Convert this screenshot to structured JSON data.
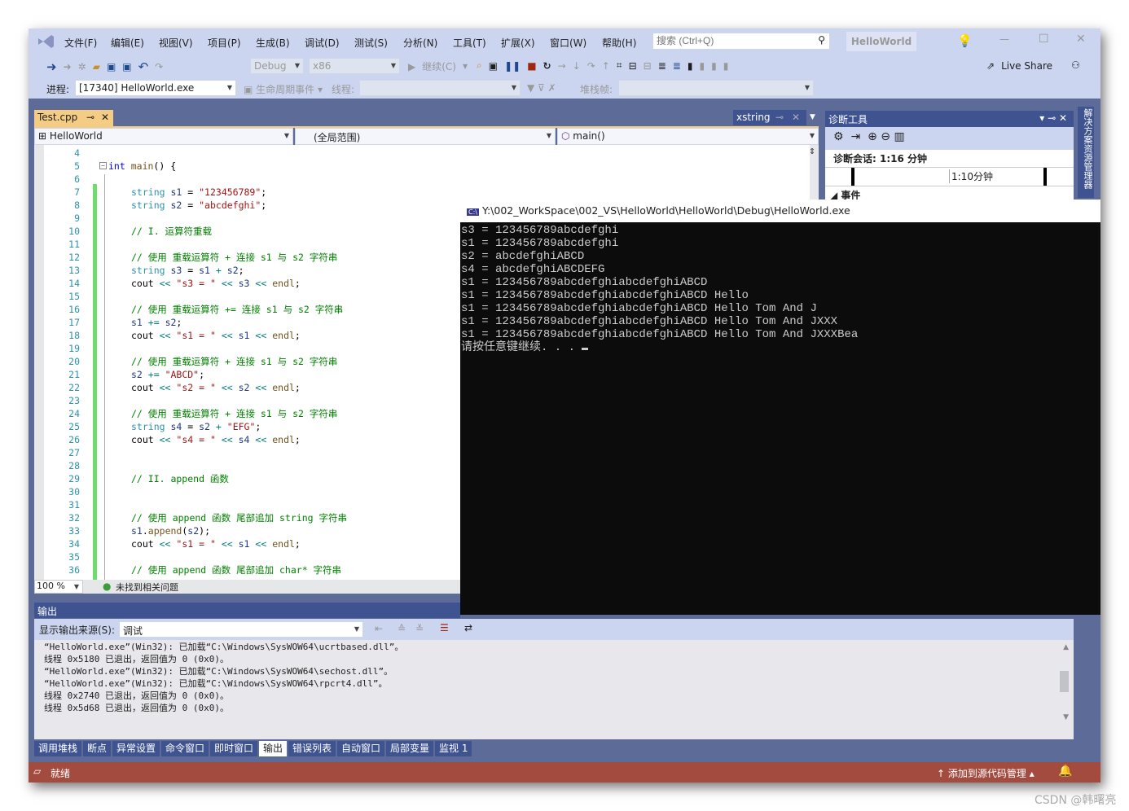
{
  "menu": [
    "文件(F)",
    "编辑(E)",
    "视图(V)",
    "项目(P)",
    "生成(B)",
    "调试(D)",
    "测试(S)",
    "分析(N)",
    "工具(T)",
    "扩展(X)",
    "窗口(W)",
    "帮助(H)"
  ],
  "search": {
    "placeholder": "搜索 (Ctrl+Q)"
  },
  "solution_name": "HelloWorld",
  "toolbar": {
    "config": "Debug",
    "platform": "x86",
    "continue": "继续(C)",
    "live_share": "Live Share"
  },
  "debugbar": {
    "process_label": "进程:",
    "process_value": "[17340] HelloWorld.exe",
    "lifecycle": "生命周期事件",
    "thread_label": "线程:",
    "stack_label": "堆栈帧:"
  },
  "tabs": {
    "active": "Test.cpp",
    "other": "xstring"
  },
  "navbar": {
    "project": "HelloWorld",
    "scope": "(全局范围)",
    "member": "main()"
  },
  "code": [
    {
      "n": "4",
      "t": []
    },
    {
      "n": "5",
      "t": [
        [
          "kw",
          "int"
        ],
        [
          "pl",
          " "
        ],
        [
          "fn",
          "main"
        ],
        [
          "pl",
          "() {"
        ]
      ],
      "root": true
    },
    {
      "n": "6",
      "t": []
    },
    {
      "n": "7",
      "t": [
        [
          "ty",
          "string"
        ],
        [
          "pl",
          " "
        ],
        [
          "va",
          "s1"
        ],
        [
          "pl",
          " = "
        ],
        [
          "st",
          "\"123456789\""
        ],
        [
          "pl",
          ";"
        ]
      ]
    },
    {
      "n": "8",
      "t": [
        [
          "ty",
          "string"
        ],
        [
          "pl",
          " "
        ],
        [
          "va",
          "s2"
        ],
        [
          "pl",
          " = "
        ],
        [
          "st",
          "\"abcdefghi\""
        ],
        [
          "pl",
          ";"
        ]
      ]
    },
    {
      "n": "9",
      "t": []
    },
    {
      "n": "10",
      "t": [
        [
          "cm",
          "// I. 运算符重载"
        ]
      ]
    },
    {
      "n": "11",
      "t": []
    },
    {
      "n": "12",
      "t": [
        [
          "cm",
          "// 使用 重载运算符 + 连接 s1 与 s2 字符串"
        ]
      ]
    },
    {
      "n": "13",
      "t": [
        [
          "ty",
          "string"
        ],
        [
          "pl",
          " "
        ],
        [
          "va",
          "s3"
        ],
        [
          "pl",
          " = "
        ],
        [
          "va",
          "s1"
        ],
        [
          "op",
          " + "
        ],
        [
          "va",
          "s2"
        ],
        [
          "pl",
          ";"
        ]
      ]
    },
    {
      "n": "14",
      "t": [
        [
          "pl",
          "cout "
        ],
        [
          "op",
          "<<"
        ],
        [
          "pl",
          " "
        ],
        [
          "st",
          "\"s3 = \""
        ],
        [
          "pl",
          " "
        ],
        [
          "op",
          "<<"
        ],
        [
          "pl",
          " "
        ],
        [
          "va",
          "s3"
        ],
        [
          "pl",
          " "
        ],
        [
          "op",
          "<<"
        ],
        [
          "pl",
          " "
        ],
        [
          "fn",
          "endl"
        ],
        [
          "pl",
          ";"
        ]
      ]
    },
    {
      "n": "15",
      "t": []
    },
    {
      "n": "16",
      "t": [
        [
          "cm",
          "// 使用 重载运算符 += 连接 s1 与 s2 字符串"
        ]
      ]
    },
    {
      "n": "17",
      "t": [
        [
          "va",
          "s1"
        ],
        [
          "op",
          " += "
        ],
        [
          "va",
          "s2"
        ],
        [
          "pl",
          ";"
        ]
      ]
    },
    {
      "n": "18",
      "t": [
        [
          "pl",
          "cout "
        ],
        [
          "op",
          "<<"
        ],
        [
          "pl",
          " "
        ],
        [
          "st",
          "\"s1 = \""
        ],
        [
          "pl",
          " "
        ],
        [
          "op",
          "<<"
        ],
        [
          "pl",
          " "
        ],
        [
          "va",
          "s1"
        ],
        [
          "pl",
          " "
        ],
        [
          "op",
          "<<"
        ],
        [
          "pl",
          " "
        ],
        [
          "fn",
          "endl"
        ],
        [
          "pl",
          ";"
        ]
      ]
    },
    {
      "n": "19",
      "t": []
    },
    {
      "n": "20",
      "t": [
        [
          "cm",
          "// 使用 重载运算符 + 连接 s1 与 s2 字符串"
        ]
      ]
    },
    {
      "n": "21",
      "t": [
        [
          "va",
          "s2"
        ],
        [
          "op",
          " += "
        ],
        [
          "st",
          "\"ABCD\""
        ],
        [
          "pl",
          ";"
        ]
      ]
    },
    {
      "n": "22",
      "t": [
        [
          "pl",
          "cout "
        ],
        [
          "op",
          "<<"
        ],
        [
          "pl",
          " "
        ],
        [
          "st",
          "\"s2 = \""
        ],
        [
          "pl",
          " "
        ],
        [
          "op",
          "<<"
        ],
        [
          "pl",
          " "
        ],
        [
          "va",
          "s2"
        ],
        [
          "pl",
          " "
        ],
        [
          "op",
          "<<"
        ],
        [
          "pl",
          " "
        ],
        [
          "fn",
          "endl"
        ],
        [
          "pl",
          ";"
        ]
      ]
    },
    {
      "n": "23",
      "t": []
    },
    {
      "n": "24",
      "t": [
        [
          "cm",
          "// 使用 重载运算符 + 连接 s1 与 s2 字符串"
        ]
      ]
    },
    {
      "n": "25",
      "t": [
        [
          "ty",
          "string"
        ],
        [
          "pl",
          " "
        ],
        [
          "va",
          "s4"
        ],
        [
          "pl",
          " = "
        ],
        [
          "va",
          "s2"
        ],
        [
          "op",
          " + "
        ],
        [
          "st",
          "\"EFG\""
        ],
        [
          "pl",
          ";"
        ]
      ]
    },
    {
      "n": "26",
      "t": [
        [
          "pl",
          "cout "
        ],
        [
          "op",
          "<<"
        ],
        [
          "pl",
          " "
        ],
        [
          "st",
          "\"s4 = \""
        ],
        [
          "pl",
          " "
        ],
        [
          "op",
          "<<"
        ],
        [
          "pl",
          " "
        ],
        [
          "va",
          "s4"
        ],
        [
          "pl",
          " "
        ],
        [
          "op",
          "<<"
        ],
        [
          "pl",
          " "
        ],
        [
          "fn",
          "endl"
        ],
        [
          "pl",
          ";"
        ]
      ]
    },
    {
      "n": "27",
      "t": []
    },
    {
      "n": "28",
      "t": []
    },
    {
      "n": "29",
      "t": [
        [
          "cm",
          "// II. append 函数"
        ]
      ]
    },
    {
      "n": "30",
      "t": []
    },
    {
      "n": "31",
      "t": []
    },
    {
      "n": "32",
      "t": [
        [
          "cm",
          "// 使用 append 函数 尾部追加 string 字符串"
        ]
      ]
    },
    {
      "n": "33",
      "t": [
        [
          "va",
          "s1"
        ],
        [
          "pl",
          "."
        ],
        [
          "fn",
          "append"
        ],
        [
          "pl",
          "("
        ],
        [
          "va",
          "s2"
        ],
        [
          "pl",
          ");"
        ]
      ]
    },
    {
      "n": "34",
      "t": [
        [
          "pl",
          "cout "
        ],
        [
          "op",
          "<<"
        ],
        [
          "pl",
          " "
        ],
        [
          "st",
          "\"s1 = \""
        ],
        [
          "pl",
          " "
        ],
        [
          "op",
          "<<"
        ],
        [
          "pl",
          " "
        ],
        [
          "va",
          "s1"
        ],
        [
          "pl",
          " "
        ],
        [
          "op",
          "<<"
        ],
        [
          "pl",
          " "
        ],
        [
          "fn",
          "endl"
        ],
        [
          "pl",
          ";"
        ]
      ]
    },
    {
      "n": "35",
      "t": []
    },
    {
      "n": "36",
      "t": [
        [
          "cm",
          "// 使用 append 函数 尾部追加 char* 字符串"
        ]
      ]
    }
  ],
  "editor_status": {
    "zoom": "100 %",
    "issues": "未找到相关问题"
  },
  "diagnostics": {
    "title": "诊断工具",
    "session": "诊断会话: 1:16 分钟",
    "timeline_label": "1:10分钟",
    "events": "事件"
  },
  "solution_explorer_tab": "解决方案资源管理器",
  "console": {
    "title": "Y:\\002_WorkSpace\\002_VS\\HelloWorld\\HelloWorld\\Debug\\HelloWorld.exe",
    "lines": [
      "s3 = 123456789abcdefghi",
      "s1 = 123456789abcdefghi",
      "s2 = abcdefghiABCD",
      "s4 = abcdefghiABCDEFG",
      "s1 = 123456789abcdefghiabcdefghiABCD",
      "s1 = 123456789abcdefghiabcdefghiABCD Hello",
      "s1 = 123456789abcdefghiabcdefghiABCD Hello Tom And J",
      "s1 = 123456789abcdefghiabcdefghiABCD Hello Tom And JXXX",
      "s1 = 123456789abcdefghiabcdefghiABCD Hello Tom And JXXXBea"
    ],
    "prompt": "请按任意键继续. . . "
  },
  "output": {
    "title": "输出",
    "source_label": "显示输出来源(S):",
    "source_value": "调试",
    "lines": [
      "“HelloWorld.exe”(Win32): 已加载“C:\\Windows\\SysWOW64\\ucrtbased.dll”。",
      "线程 0x5180 已退出，返回值为 0 (0x0)。",
      "“HelloWorld.exe”(Win32): 已加载“C:\\Windows\\SysWOW64\\sechost.dll”。",
      "“HelloWorld.exe”(Win32): 已加载“C:\\Windows\\SysWOW64\\rpcrt4.dll”。",
      "线程 0x2740 已退出，返回值为 0 (0x0)。",
      "线程 0x5d68 已退出，返回值为 0 (0x0)。"
    ]
  },
  "bottom_tabs": [
    {
      "label": "调用堆栈"
    },
    {
      "label": "断点"
    },
    {
      "label": "异常设置"
    },
    {
      "label": "命令窗口"
    },
    {
      "label": "即时窗口"
    },
    {
      "label": "输出",
      "active": true
    },
    {
      "label": "错误列表"
    },
    {
      "label": "自动窗口"
    },
    {
      "label": "局部变量"
    },
    {
      "label": "监视 1"
    }
  ],
  "statusbar": {
    "state": "就绪",
    "source_control": "添加到源代码管理"
  },
  "watermark": "CSDN @韩曙亮",
  "colors": {
    "chrome": "#CCD5F0",
    "frame": "#5D6B99",
    "status": "#A44B40",
    "tab_active": "#F5CC84"
  }
}
